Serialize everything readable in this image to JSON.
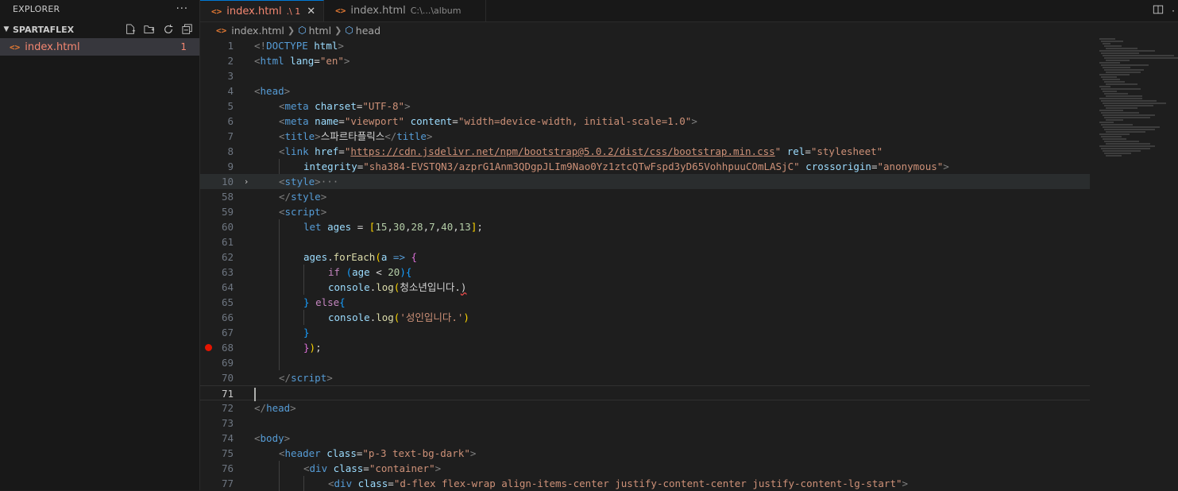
{
  "sidebar": {
    "title": "EXPLORER",
    "more": "···",
    "folder": "SPARTAFLEX",
    "file": {
      "name": "index.html",
      "badge": "1"
    }
  },
  "tabs": [
    {
      "label": "index.html",
      "desc": ".\\ 1",
      "active": true
    },
    {
      "label": "index.html",
      "desc": "C:\\...\\album",
      "active": false
    }
  ],
  "breadcrumb": {
    "file": "index.html",
    "node1": "html",
    "node2": "head"
  },
  "editor": {
    "current_line": "71",
    "lines": [
      {
        "n": "1",
        "indent": 0,
        "tokens": [
          [
            "pun",
            "<!"
          ],
          [
            "tag",
            "DOCTYPE"
          ],
          [
            "txt",
            " "
          ],
          [
            "att",
            "html"
          ],
          [
            "pun",
            ">"
          ]
        ]
      },
      {
        "n": "2",
        "indent": 0,
        "tokens": [
          [
            "pun",
            "<"
          ],
          [
            "tag",
            "html"
          ],
          [
            "txt",
            " "
          ],
          [
            "att",
            "lang"
          ],
          [
            "txt",
            "="
          ],
          [
            "str",
            "\"en\""
          ],
          [
            "pun",
            ">"
          ]
        ]
      },
      {
        "n": "3",
        "indent": 0,
        "tokens": []
      },
      {
        "n": "4",
        "indent": 0,
        "tokens": [
          [
            "pun",
            "<"
          ],
          [
            "tag",
            "head"
          ],
          [
            "pun",
            ">"
          ]
        ]
      },
      {
        "n": "5",
        "indent": 1,
        "tokens": [
          [
            "pun",
            "<"
          ],
          [
            "tag",
            "meta"
          ],
          [
            "txt",
            " "
          ],
          [
            "att",
            "charset"
          ],
          [
            "txt",
            "="
          ],
          [
            "str",
            "\"UTF-8\""
          ],
          [
            "pun",
            ">"
          ]
        ]
      },
      {
        "n": "6",
        "indent": 1,
        "tokens": [
          [
            "pun",
            "<"
          ],
          [
            "tag",
            "meta"
          ],
          [
            "txt",
            " "
          ],
          [
            "att",
            "name"
          ],
          [
            "txt",
            "="
          ],
          [
            "str",
            "\"viewport\""
          ],
          [
            "txt",
            " "
          ],
          [
            "att",
            "content"
          ],
          [
            "txt",
            "="
          ],
          [
            "str",
            "\"width=device-width, initial-scale=1.0\""
          ],
          [
            "pun",
            ">"
          ]
        ]
      },
      {
        "n": "7",
        "indent": 1,
        "tokens": [
          [
            "pun",
            "<"
          ],
          [
            "tag",
            "title"
          ],
          [
            "pun",
            ">"
          ],
          [
            "txt",
            "스파르타플릭스"
          ],
          [
            "pun",
            "</"
          ],
          [
            "tag",
            "title"
          ],
          [
            "pun",
            ">"
          ]
        ]
      },
      {
        "n": "8",
        "indent": 1,
        "tokens": [
          [
            "pun",
            "<"
          ],
          [
            "tag",
            "link"
          ],
          [
            "txt",
            " "
          ],
          [
            "att",
            "href"
          ],
          [
            "txt",
            "="
          ],
          [
            "str",
            "\""
          ],
          [
            "link",
            "https://cdn.jsdelivr.net/npm/bootstrap@5.0.2/dist/css/bootstrap.min.css"
          ],
          [
            "str",
            "\""
          ],
          [
            "txt",
            " "
          ],
          [
            "att",
            "rel"
          ],
          [
            "txt",
            "="
          ],
          [
            "str",
            "\"stylesheet\""
          ]
        ]
      },
      {
        "n": "9",
        "indent": 2,
        "tokens": [
          [
            "att",
            "integrity"
          ],
          [
            "txt",
            "="
          ],
          [
            "str",
            "\"sha384-EVSTQN3/azprG1Anm3QDgpJLIm9Nao0Yz1ztcQTwFspd3yD65VohhpuuCOmLASjC\""
          ],
          [
            "txt",
            " "
          ],
          [
            "att",
            "crossorigin"
          ],
          [
            "txt",
            "="
          ],
          [
            "str",
            "\"anonymous\""
          ],
          [
            "pun",
            ">"
          ]
        ]
      },
      {
        "n": "10",
        "indent": 1,
        "fold": "›",
        "hl": true,
        "tokens": [
          [
            "pun",
            "<"
          ],
          [
            "tag",
            "style"
          ],
          [
            "pun",
            ">"
          ],
          [
            "fold",
            "···"
          ]
        ]
      },
      {
        "n": "58",
        "indent": 1,
        "tokens": [
          [
            "pun",
            "</"
          ],
          [
            "tag",
            "style"
          ],
          [
            "pun",
            ">"
          ]
        ]
      },
      {
        "n": "59",
        "indent": 1,
        "tokens": [
          [
            "pun",
            "<"
          ],
          [
            "tag",
            "script"
          ],
          [
            "pun",
            ">"
          ]
        ]
      },
      {
        "n": "60",
        "indent": 2,
        "tokens": [
          [
            "tag",
            "let"
          ],
          [
            "txt",
            " "
          ],
          [
            "var",
            "ages"
          ],
          [
            "txt",
            " = "
          ],
          [
            "br1",
            "["
          ],
          [
            "num",
            "15"
          ],
          [
            "txt",
            ","
          ],
          [
            "num",
            "30"
          ],
          [
            "txt",
            ","
          ],
          [
            "num",
            "28"
          ],
          [
            "txt",
            ","
          ],
          [
            "num",
            "7"
          ],
          [
            "txt",
            ","
          ],
          [
            "num",
            "40"
          ],
          [
            "txt",
            ","
          ],
          [
            "num",
            "13"
          ],
          [
            "br1",
            "]"
          ],
          [
            "txt",
            ";"
          ]
        ]
      },
      {
        "n": "61",
        "indent": 2,
        "tokens": []
      },
      {
        "n": "62",
        "indent": 2,
        "tokens": [
          [
            "var",
            "ages"
          ],
          [
            "txt",
            "."
          ],
          [
            "fn",
            "forEach"
          ],
          [
            "br1",
            "("
          ],
          [
            "var",
            "a"
          ],
          [
            "txt",
            " "
          ],
          [
            "tag",
            "=>"
          ],
          [
            "txt",
            " "
          ],
          [
            "br2",
            "{"
          ]
        ]
      },
      {
        "n": "63",
        "indent": 3,
        "tokens": [
          [
            "kw",
            "if"
          ],
          [
            "txt",
            " "
          ],
          [
            "br3",
            "("
          ],
          [
            "var",
            "age"
          ],
          [
            "txt",
            " < "
          ],
          [
            "num",
            "20"
          ],
          [
            "br3",
            ")"
          ],
          [
            "br3",
            "{"
          ]
        ]
      },
      {
        "n": "64",
        "indent": 3,
        "tokens": [
          [
            "var",
            "console"
          ],
          [
            "txt",
            "."
          ],
          [
            "fn",
            "log"
          ],
          [
            "br1",
            "("
          ],
          [
            "txt",
            "청소년입니다."
          ],
          [
            "err",
            ")"
          ]
        ]
      },
      {
        "n": "65",
        "indent": 2,
        "tokens": [
          [
            "br3",
            "}"
          ],
          [
            "txt",
            " "
          ],
          [
            "kw",
            "else"
          ],
          [
            "br3",
            "{"
          ]
        ]
      },
      {
        "n": "66",
        "indent": 3,
        "tokens": [
          [
            "var",
            "console"
          ],
          [
            "txt",
            "."
          ],
          [
            "fn",
            "log"
          ],
          [
            "br1",
            "("
          ],
          [
            "str",
            "'성인입니다.'"
          ],
          [
            "br1",
            ")"
          ]
        ]
      },
      {
        "n": "67",
        "indent": 2,
        "tokens": [
          [
            "br3",
            "}"
          ]
        ]
      },
      {
        "n": "68",
        "indent": 2,
        "bp": true,
        "tokens": [
          [
            "br2",
            "}"
          ],
          [
            "br1",
            ")"
          ],
          [
            "txt",
            ";"
          ]
        ]
      },
      {
        "n": "69",
        "indent": 2,
        "tokens": []
      },
      {
        "n": "70",
        "indent": 1,
        "tokens": [
          [
            "pun",
            "</"
          ],
          [
            "tag",
            "script"
          ],
          [
            "pun",
            ">"
          ]
        ]
      },
      {
        "n": "71",
        "indent": 0,
        "cur": true,
        "tokens": []
      },
      {
        "n": "72",
        "indent": 0,
        "tokens": [
          [
            "pun",
            "</"
          ],
          [
            "tag",
            "head"
          ],
          [
            "pun",
            ">"
          ]
        ]
      },
      {
        "n": "73",
        "indent": 0,
        "tokens": []
      },
      {
        "n": "74",
        "indent": 0,
        "tokens": [
          [
            "pun",
            "<"
          ],
          [
            "tag",
            "body"
          ],
          [
            "pun",
            ">"
          ]
        ]
      },
      {
        "n": "75",
        "indent": 1,
        "tokens": [
          [
            "pun",
            "<"
          ],
          [
            "tag",
            "header"
          ],
          [
            "txt",
            " "
          ],
          [
            "att",
            "class"
          ],
          [
            "txt",
            "="
          ],
          [
            "str",
            "\"p-3 text-bg-dark\""
          ],
          [
            "pun",
            ">"
          ]
        ]
      },
      {
        "n": "76",
        "indent": 2,
        "tokens": [
          [
            "pun",
            "<"
          ],
          [
            "tag",
            "div"
          ],
          [
            "txt",
            " "
          ],
          [
            "att",
            "class"
          ],
          [
            "txt",
            "="
          ],
          [
            "str",
            "\"container\""
          ],
          [
            "pun",
            ">"
          ]
        ]
      },
      {
        "n": "77",
        "indent": 3,
        "tokens": [
          [
            "pun",
            "<"
          ],
          [
            "tag",
            "div"
          ],
          [
            "txt",
            " "
          ],
          [
            "att",
            "class"
          ],
          [
            "txt",
            "="
          ],
          [
            "str",
            "\"d-flex flex-wrap align-items-center justify-content-center justify-content-lg-start\""
          ],
          [
            "pun",
            ">"
          ]
        ]
      }
    ]
  }
}
